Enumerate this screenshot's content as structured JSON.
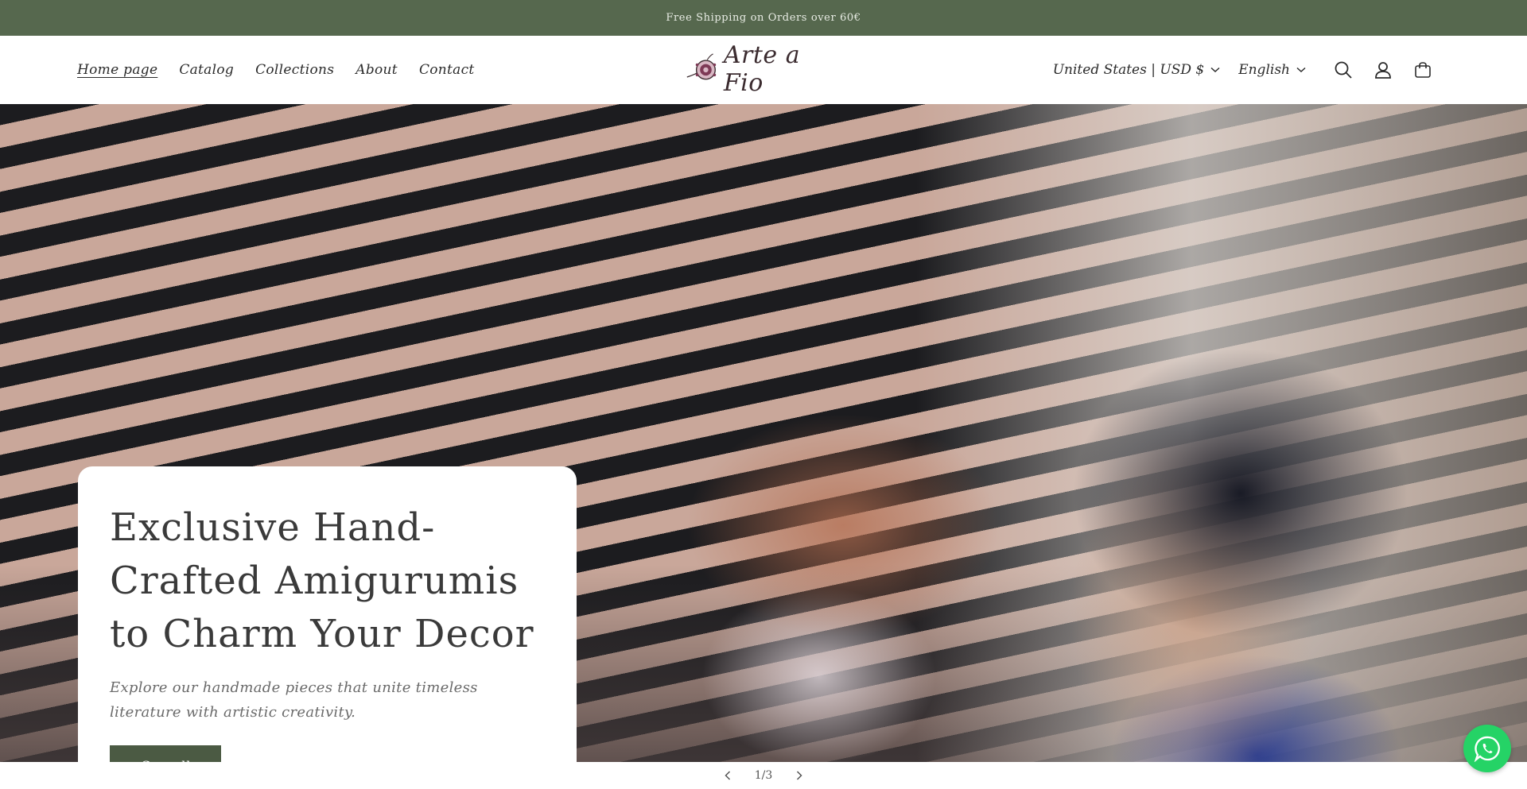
{
  "announcement": {
    "text": "Free Shipping on Orders over 60€"
  },
  "nav": {
    "items": [
      {
        "label": "Home page"
      },
      {
        "label": "Catalog"
      },
      {
        "label": "Collections"
      },
      {
        "label": "About"
      },
      {
        "label": "Contact"
      }
    ]
  },
  "logo": {
    "text": "Arte a Fio",
    "icon": "crochet-flower-logo"
  },
  "header": {
    "country_selector": "United States | USD $",
    "language_selector": "English",
    "icons": [
      "search-icon",
      "account-icon",
      "cart-icon"
    ]
  },
  "hero": {
    "title": "Exclusive Hand-Crafted Amigurumis to Charm Your Decor",
    "subtitle": "Explore our handmade pieces that unite timeless literature with artistic creativity.",
    "button_label": "See all"
  },
  "slider": {
    "counter": "1/3"
  },
  "floating": {
    "icon": "whatsapp-icon"
  },
  "colors": {
    "announcement_bg": "#56684e",
    "button_bg": "#4b5a43",
    "whatsapp": "#25d366"
  }
}
